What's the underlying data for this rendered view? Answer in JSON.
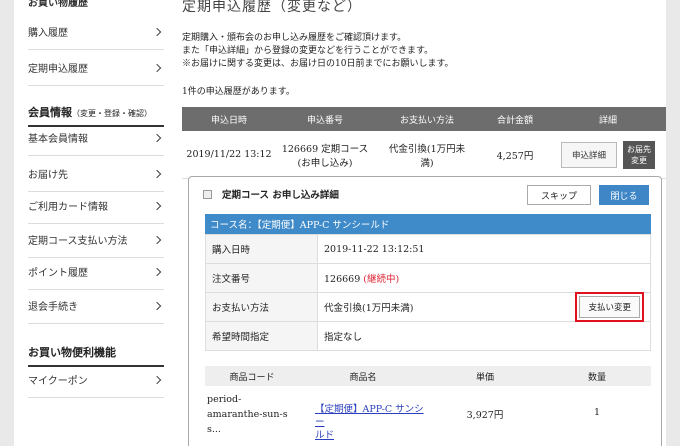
{
  "sidebar": {
    "top_heading": "お買い物履歴",
    "group1": [
      "購入履歴",
      "定期申込履歴"
    ],
    "member_heading": "会員情報",
    "member_heading_sub": "（変更・登録・確認）",
    "group2": [
      "基本会員情報",
      "お届け先",
      "ご利用カード情報",
      "定期コース支払い方法",
      "ポイント履歴",
      "退会手続き"
    ],
    "shopping_heading": "お買い物便利機能",
    "group3": [
      "マイクーポン"
    ]
  },
  "main": {
    "title": "定期申込履歴（変更など）",
    "desc_lines": [
      "定期購入・頒布会のお申し込み履歴をご確認頂けます。",
      "また「申込詳細」から登録の変更などを行うことができます。",
      "※お届けに関する変更は、お届け日の10日前までにお願いします。"
    ],
    "count_text": "1件の申込履歴があります。"
  },
  "history_table": {
    "headers": [
      "申込日時",
      "申込番号",
      "お支払い方法",
      "合計金額",
      "詳細"
    ],
    "row": {
      "date": "2019/11/22 13:12",
      "number_line1": "126669 定期コース",
      "number_line2": "(お申し込み)",
      "payment_line1": "代金引換(1万円未",
      "payment_line2": "満)",
      "total": "4,257円",
      "detail_button": "申込詳細",
      "addr_button_line1": "お届先",
      "addr_button_line2": "変更"
    }
  },
  "detail_panel": {
    "heading": "定期コース お申し込み詳細",
    "skip_button": "スキップ",
    "close_button": "閉じる",
    "course_name": "コース名：【定期便】APP-C サンシールド",
    "info": [
      {
        "key": "購入日時",
        "value": "2019-11-22 13:12:51"
      },
      {
        "key": "注文番号",
        "value": "126669",
        "status": "(継続中)"
      },
      {
        "key": "お支払い方法",
        "value": "代金引換(1万円未満)",
        "button": "支払い変更"
      },
      {
        "key": "希望時間指定",
        "value": "指定なし"
      }
    ],
    "product_headers": [
      "商品コード",
      "商品名",
      "単価",
      "数量"
    ],
    "product_row": {
      "code_line1": "period-",
      "code_line2": "amaranthe-sun-s",
      "code_line3": "s...",
      "name_line1": "【定期便】APP-C サンシー",
      "name_line2": "ルド",
      "price": "3,927円",
      "qty": "1"
    }
  },
  "colors": {
    "accent_blue": "#3f8ac9",
    "header_gray": "#6d6d6d",
    "highlight_red": "#e0121d",
    "status_red": "#d23"
  }
}
